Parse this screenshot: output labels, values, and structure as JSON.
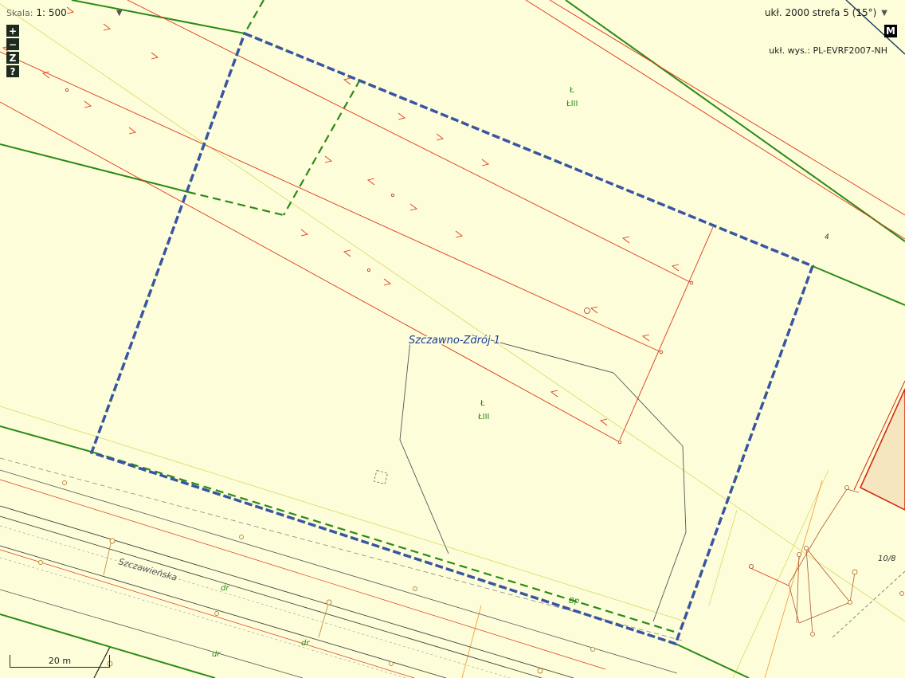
{
  "scale": {
    "label": "Skala:",
    "value": "1: 500",
    "dropdown_arrow": "▼"
  },
  "zoom_controls": [
    {
      "name": "zoom-in-button",
      "label": "+"
    },
    {
      "name": "zoom-out-button",
      "label": "−"
    },
    {
      "name": "zoom-extent-button",
      "label": "Z"
    },
    {
      "name": "help-button",
      "label": "?"
    }
  ],
  "coordinate_system": {
    "label": "ukł. 2000 strefa 5 (15°)",
    "dropdown_arrow": "▼"
  },
  "map_button": {
    "label": "M"
  },
  "height_system": {
    "label": "ukł. wys.: PL-EVRF2007-NH"
  },
  "scale_bar": {
    "label": "20 m"
  },
  "map_labels": {
    "parcel_region_label": "Szczawno-Zdrój 1",
    "street_name": "Szczawieńska",
    "parcel_number_4": "4",
    "parcel_number_10_8": "10/8",
    "landuse_upper_symbol": "Ł",
    "landuse_upper_class": "ŁIII",
    "landuse_center_symbol": "Ł",
    "landuse_center_class": "ŁIII",
    "landuse_bp": "Bp",
    "landuse_dr_1": "dr",
    "landuse_dr_2": "dr",
    "landuse_dr_3": "dr"
  },
  "colors": {
    "background": "#fdfed9",
    "parcel_boundary": "#2b8a18",
    "selected_parcel": "#3a52a8",
    "power_line": "#e0341c",
    "building_fill": "#f5e6c0",
    "building_outline": "#d42a12"
  }
}
